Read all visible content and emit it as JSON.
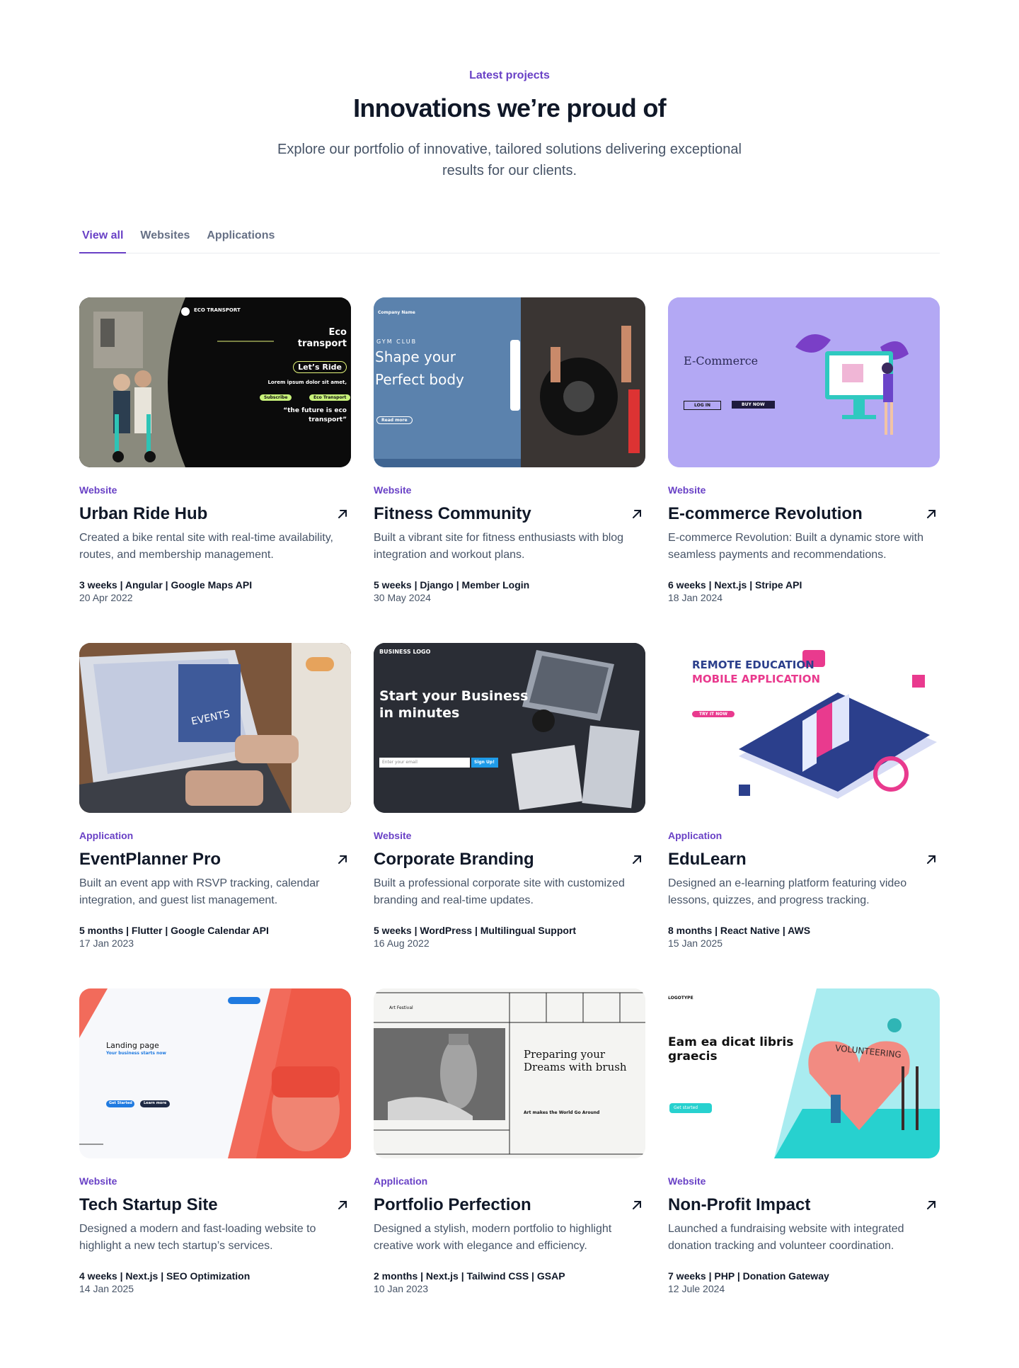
{
  "header": {
    "eyebrow": "Latest projects",
    "title": "Innovations we’re proud of",
    "subtitle": "Explore our portfolio of innovative, tailored solutions delivering exceptional results for our clients."
  },
  "tabs": [
    {
      "label": "View all",
      "active": true
    },
    {
      "label": "Websites",
      "active": false
    },
    {
      "label": "Applications",
      "active": false
    }
  ],
  "projects": [
    {
      "category": "Website",
      "title": "Urban Ride Hub",
      "description": "Created a bike rental site with real-time availability, routes, and membership management.",
      "meta": "3 weeks | Angular | Google Maps API",
      "date": "20 Apr 2022",
      "thumb": {
        "lines": [
          "Eco",
          "transport",
          "Let’s Ride",
          "Lorem ipsum dolor sit amet,",
          "Subscribe",
          "Eco Transport",
          "“the future is eco",
          "transport”"
        ],
        "logo": "ECO TRANSPORT"
      }
    },
    {
      "category": "Website",
      "title": "Fitness Community",
      "description": "Built a vibrant site for fitness enthusiasts with blog integration and workout plans.",
      "meta": "5 weeks | Django | Member Login",
      "date": "30 May 2024",
      "thumb": {
        "lines": [
          "GYM CLUB",
          "Shape your",
          "Perfect body",
          "Read more"
        ],
        "logo": "Company Name"
      }
    },
    {
      "category": "Website",
      "title": "E-commerce Revolution",
      "description": "E-commerce Revolution: Built a dynamic store with seamless payments and recommendations.",
      "meta": "6 weeks | Next.js | Stripe API",
      "date": "18 Jan 2024",
      "thumb": {
        "lines": [
          "E-Commerce",
          "LOG IN",
          "BUY NOW"
        ],
        "logo": ""
      }
    },
    {
      "category": "Application",
      "title": "EventPlanner Pro",
      "description": "Built an event app with RSVP tracking, calendar integration, and guest list management.",
      "meta": "5 months | Flutter | Google Calendar API",
      "date": "17 Jan 2023",
      "thumb": {
        "lines": [
          "EVENTS"
        ],
        "logo": ""
      }
    },
    {
      "category": "Website",
      "title": "Corporate Branding",
      "description": "Built a professional corporate site with customized branding and real-time updates.",
      "meta": "5 weeks | WordPress | Multilingual Support",
      "date": "16 Aug 2022",
      "thumb": {
        "lines": [
          "Start your Business",
          "in minutes",
          "Enter your email",
          "Sign Up!"
        ],
        "logo": "BUSINESS LOGO"
      }
    },
    {
      "category": "Application",
      "title": "EduLearn",
      "description": "Designed an e-learning platform featuring video lessons, quizzes, and progress tracking.",
      "meta": "8 months | React Native | AWS",
      "date": "15 Jan 2025",
      "thumb": {
        "lines": [
          "REMOTE EDUCATION",
          "MOBILE APPLICATION",
          "TRY IT NOW"
        ],
        "logo": ""
      }
    },
    {
      "category": "Website",
      "title": "Tech Startup Site",
      "description": "Designed a modern and fast-loading website to highlight a new tech startup’s services.",
      "meta": "4 weeks | Next.js | SEO Optimization",
      "date": "14 Jan 2025",
      "thumb": {
        "lines": [
          "Landing page",
          "Your business starts now",
          "Get Started",
          "Learn more"
        ],
        "logo": ""
      }
    },
    {
      "category": "Application",
      "title": "Portfolio Perfection",
      "description": "Designed a stylish, modern portfolio to highlight creative work with elegance and efficiency.",
      "meta": "2 months | Next.js | Tailwind CSS | GSAP",
      "date": "10 Jan 2023",
      "thumb": {
        "lines": [
          "Preparing your",
          "Dreams with brush",
          "Art makes the World Go Around"
        ],
        "logo": "Art Festival"
      }
    },
    {
      "category": "Website",
      "title": "Non-Profit Impact",
      "description": "Launched a fundraising website with integrated donation tracking and volunteer coordination.",
      "meta": "7 weeks | PHP | Donation Gateway",
      "date": "12 Jule 2024",
      "thumb": {
        "lines": [
          "Eam ea dicat libris",
          "graecis",
          "Get started",
          "VOLUNTEERING"
        ],
        "logo": "LOGOTYPE"
      }
    }
  ],
  "colors": {
    "accent": "#6941c6",
    "text": "#101828",
    "muted": "#475467"
  }
}
